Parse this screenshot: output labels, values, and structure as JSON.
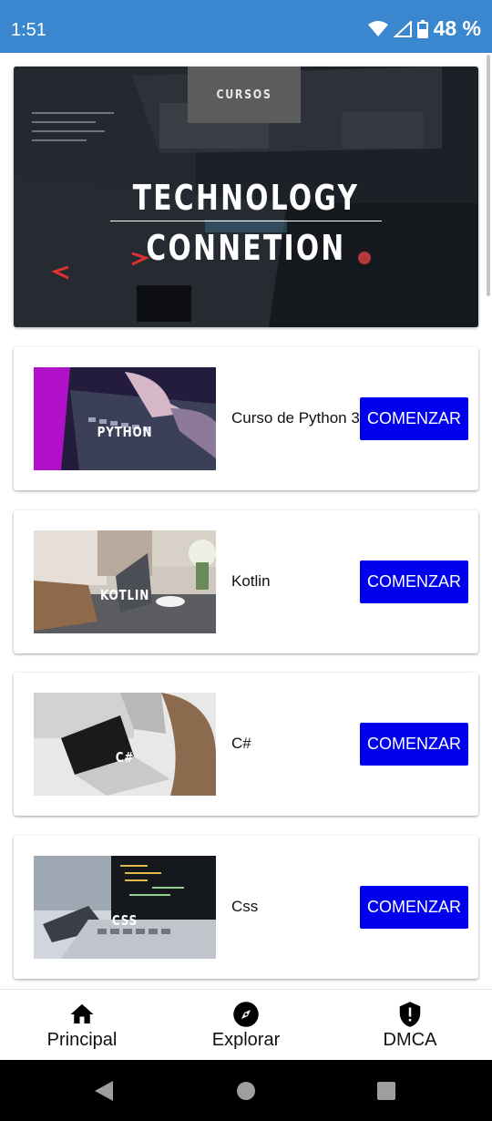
{
  "status_bar": {
    "time": "1:51",
    "battery_percent": "48 %",
    "icons": [
      "wifi-icon",
      "signal-icon",
      "battery-icon"
    ]
  },
  "banner": {
    "tag": "CURSOS",
    "title_line1": "TECHNOLOGY",
    "title_line2": "CONNETION"
  },
  "courses": [
    {
      "thumb_text": "PYTHON",
      "name": "Curso de Python 3",
      "button": "COMENZAR"
    },
    {
      "thumb_text": "KOTLIN",
      "name": "Kotlin",
      "button": "COMENZAR"
    },
    {
      "thumb_text": "C#",
      "name": "C#",
      "button": "COMENZAR"
    },
    {
      "thumb_text": "CSS",
      "name": "Css",
      "button": "COMENZAR"
    }
  ],
  "bottom_nav": {
    "items": [
      {
        "label": "Principal",
        "icon": "home-icon"
      },
      {
        "label": "Explorar",
        "icon": "compass-icon"
      },
      {
        "label": "DMCA",
        "icon": "shield-alert-icon"
      }
    ]
  },
  "system_nav": [
    "back-icon",
    "home-circle-icon",
    "recents-icon"
  ],
  "colors": {
    "status_bar": "#3a87cf",
    "button": "#0000ee",
    "background": "#ffffff"
  }
}
